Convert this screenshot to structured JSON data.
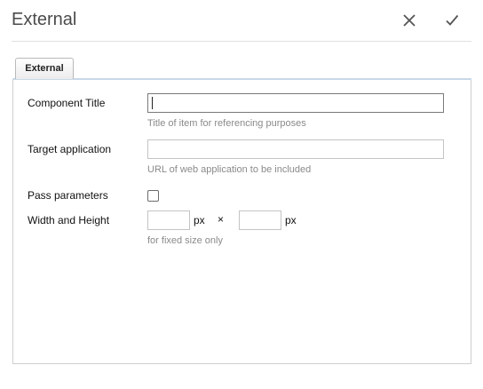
{
  "dialog": {
    "title": "External",
    "close_icon": "close-icon",
    "done_icon": "checkmark-icon"
  },
  "tabs": [
    {
      "label": "External"
    }
  ],
  "fields": {
    "component_title": {
      "label": "Component Title",
      "value": "",
      "hint": "Title of item for referencing purposes"
    },
    "target_application": {
      "label": "Target application",
      "value": "",
      "hint": "URL of web application to be included"
    },
    "pass_parameters": {
      "label": "Pass parameters",
      "checked": false
    },
    "width_height": {
      "label": "Width and Height",
      "width_value": "",
      "height_value": "",
      "unit": "px",
      "separator": "×",
      "hint": "for fixed size only"
    }
  }
}
